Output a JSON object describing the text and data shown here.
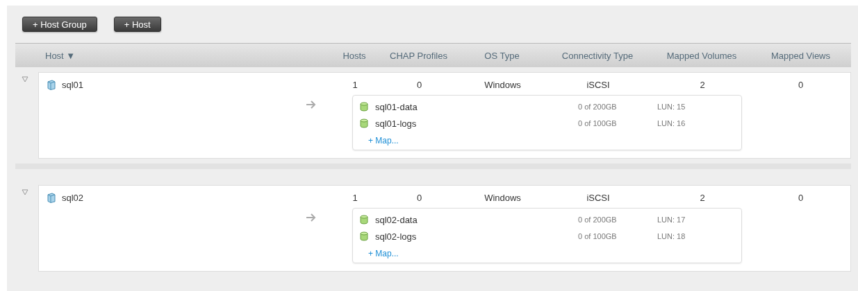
{
  "toolbar": {
    "buttons": [
      "+ Host Group",
      "+ Host"
    ]
  },
  "table": {
    "columns": [
      {
        "label": "Host",
        "sort_indicator": "▼"
      },
      {
        "label": "Hosts"
      },
      {
        "label": "CHAP Profiles"
      },
      {
        "label": "OS Type"
      },
      {
        "label": "Connectivity Type"
      },
      {
        "label": "Mapped Volumes"
      },
      {
        "label": "Mapped Views"
      }
    ],
    "rows": [
      {
        "expanded": true,
        "name": "sql01",
        "hosts": "1",
        "chap_profiles": "0",
        "os_type": "Windows",
        "connectivity_type": "iSCSI",
        "mapped_volumes": "2",
        "mapped_views": "0",
        "volumes": [
          {
            "name": "sql01-data",
            "size": "0 of 200GB",
            "lun": "LUN: 15"
          },
          {
            "name": "sql01-logs",
            "size": "0 of 100GB",
            "lun": "LUN: 16"
          }
        ],
        "map_link": "+ Map..."
      },
      {
        "expanded": true,
        "name": "sql02",
        "hosts": "1",
        "chap_profiles": "0",
        "os_type": "Windows",
        "connectivity_type": "iSCSI",
        "mapped_volumes": "2",
        "mapped_views": "0",
        "volumes": [
          {
            "name": "sql02-data",
            "size": "0 of 200GB",
            "lun": "LUN: 17"
          },
          {
            "name": "sql02-logs",
            "size": "0 of 100GB",
            "lun": "LUN: 18"
          }
        ],
        "map_link": "+ Map..."
      }
    ]
  }
}
